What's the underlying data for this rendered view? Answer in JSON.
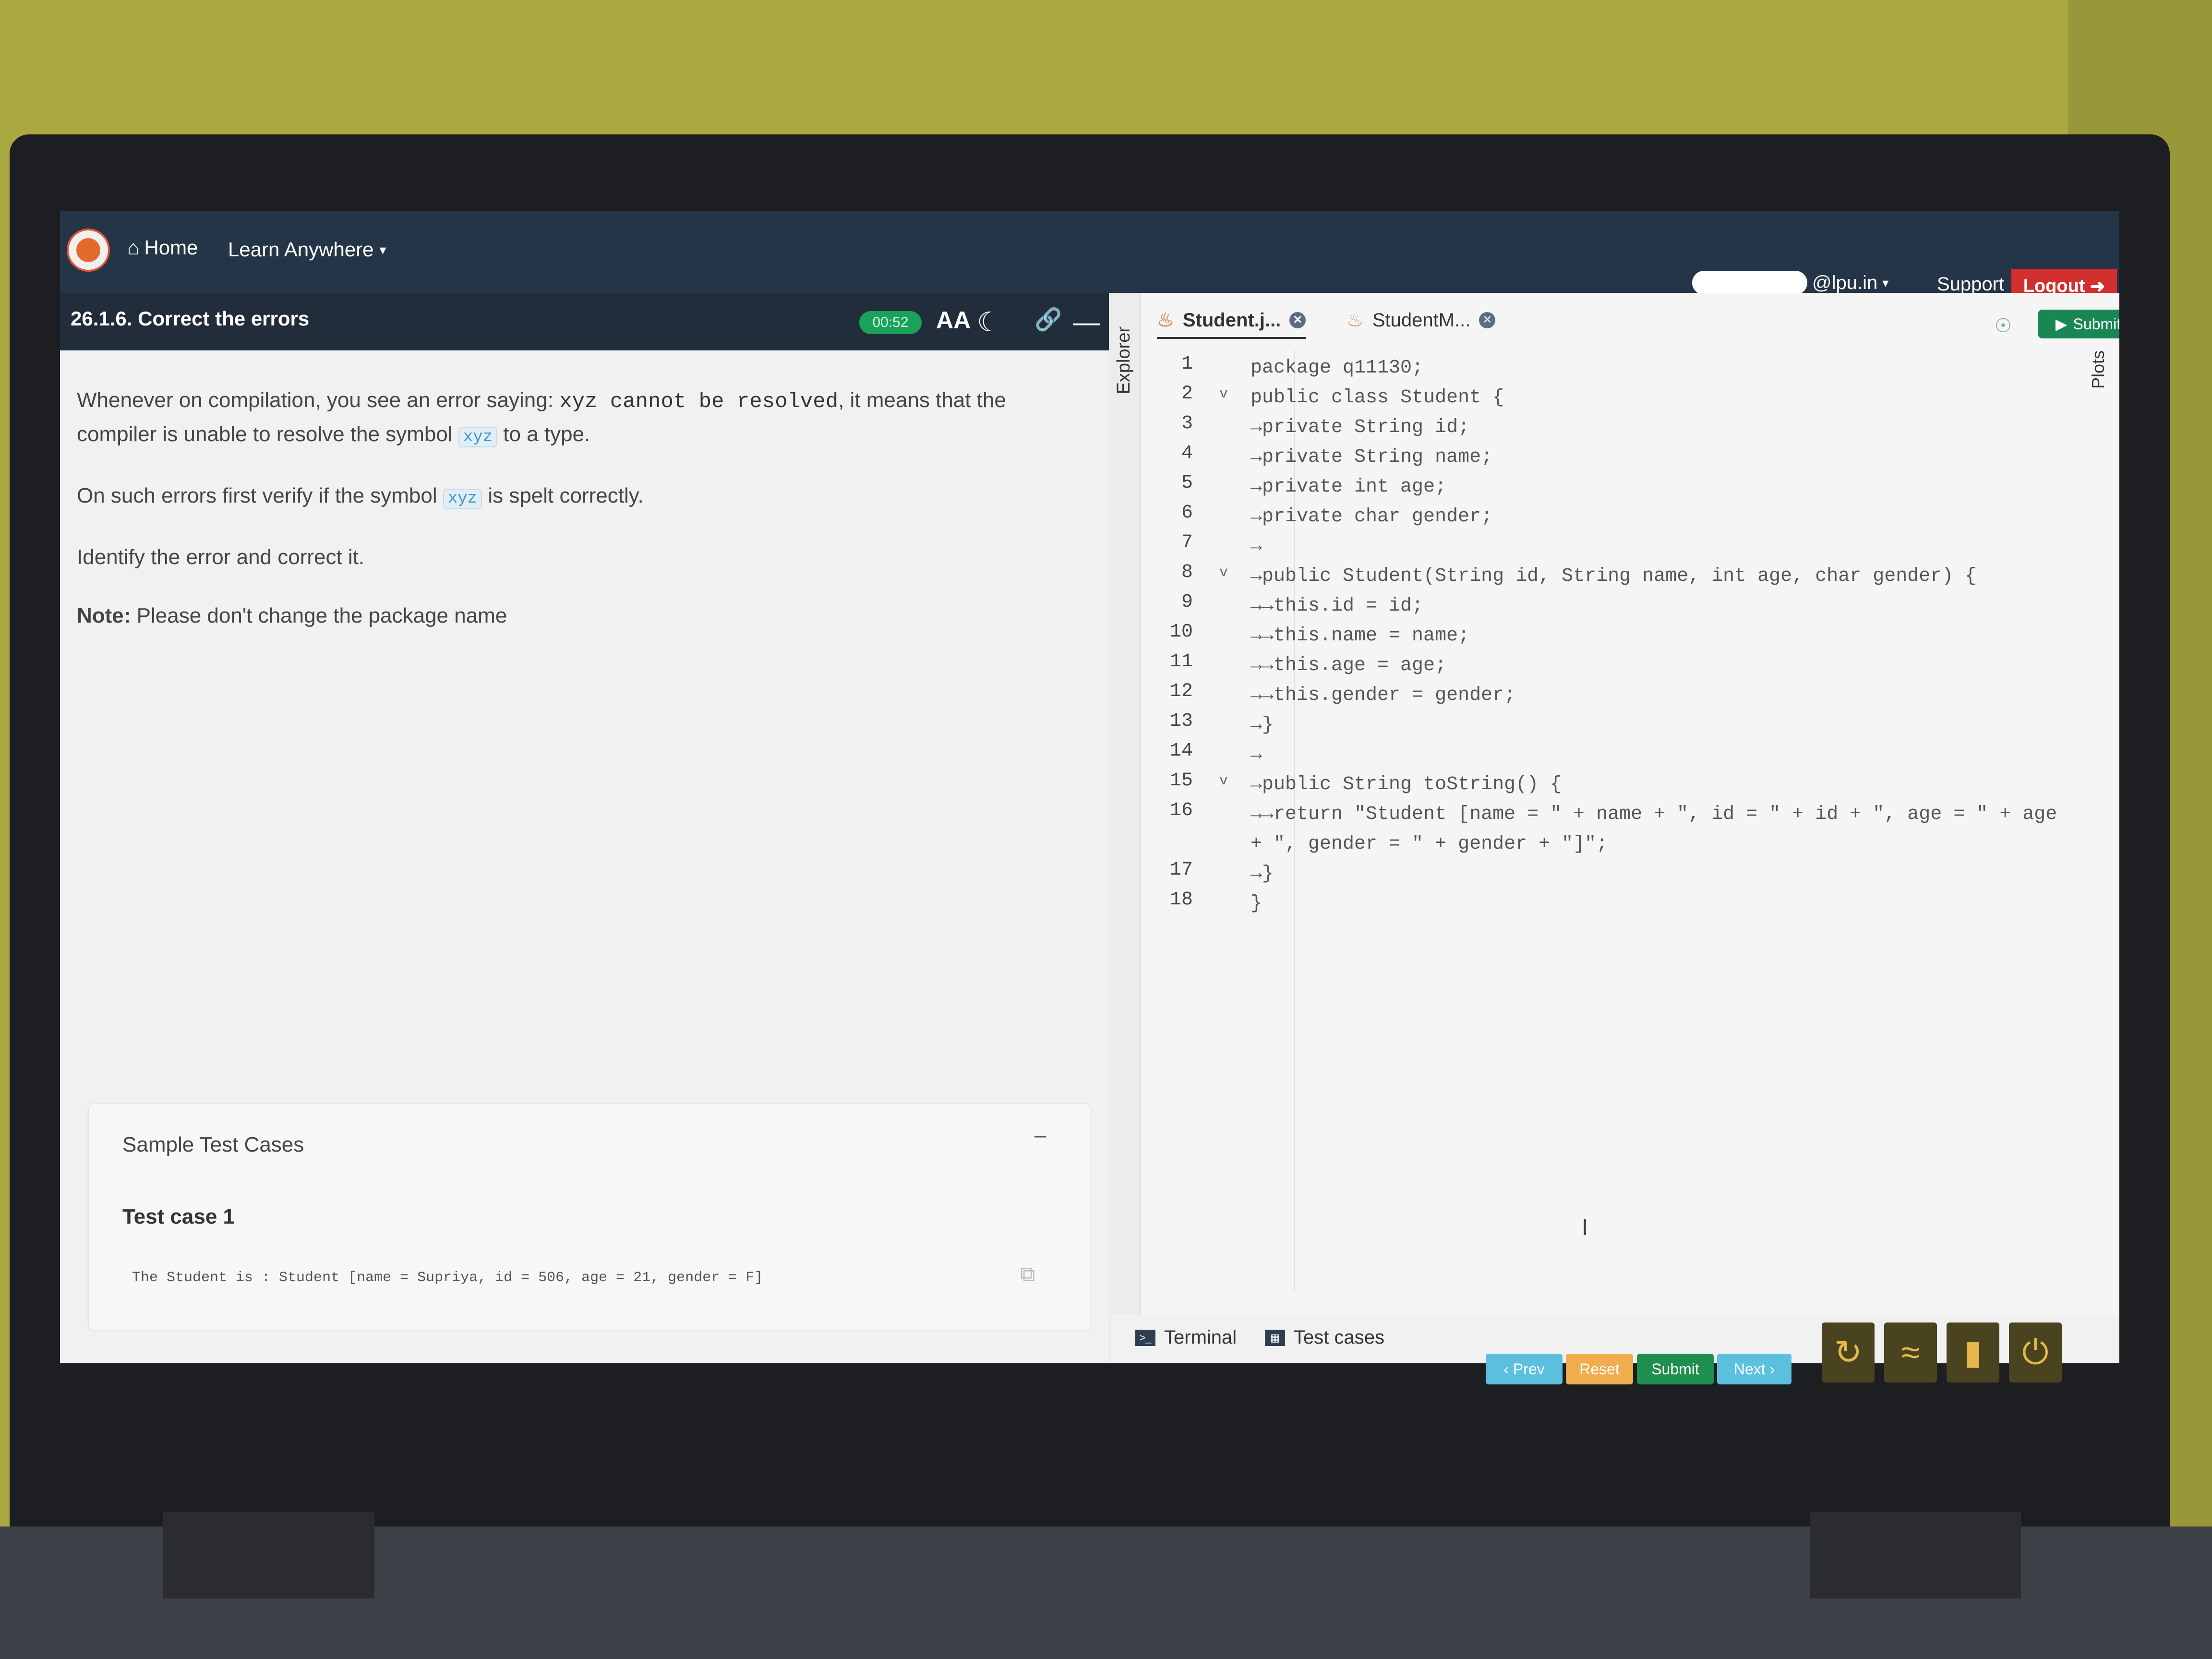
{
  "nav": {
    "home_label": "Home",
    "learn_label": "Learn Anywhere",
    "user_email_suffix": "@lpu.in",
    "support_label": "Support",
    "logout_label": "Logout"
  },
  "problem": {
    "title": "26.1.6. Correct the errors",
    "timer": "00:52",
    "para1_pre": "Whenever on compilation, you see an error saying: ",
    "para1_code": "xyz cannot be resolved",
    "para1_post": ", it means that the compiler is unable to resolve the symbol ",
    "symbol_tag": "xyz",
    "para1_end": " to a type.",
    "para2_pre": "On such errors first verify if the symbol ",
    "para2_post": " is spelt correctly.",
    "para3": "Identify the error and correct it.",
    "note_label": "Note:",
    "note_text": " Please don't change the package name"
  },
  "sample": {
    "title": "Sample Test Cases",
    "collapse": "–",
    "case_title": "Test case 1",
    "output": "The Student is : Student [name = Supriya, id = 506, age = 21, gender = F]"
  },
  "editor": {
    "explorer_label": "Explorer",
    "plots_label": "Plots",
    "tabs": [
      "Student.j...",
      "StudentM..."
    ],
    "submit_label": "Submit",
    "lines": [
      {
        "n": "1",
        "fold": "",
        "code": "package q11130;"
      },
      {
        "n": "2",
        "fold": "v",
        "code": "public class Student {"
      },
      {
        "n": "3",
        "fold": "",
        "code": "→private String id;"
      },
      {
        "n": "4",
        "fold": "",
        "code": "→private String name;"
      },
      {
        "n": "5",
        "fold": "",
        "code": "→private int age;"
      },
      {
        "n": "6",
        "fold": "",
        "code": "→private char gender;"
      },
      {
        "n": "7",
        "fold": "",
        "code": "→"
      },
      {
        "n": "8",
        "fold": "v",
        "code": "→public Student(String id, String name, int age, char gender) {"
      },
      {
        "n": "9",
        "fold": "",
        "code": "→→this.id = id;"
      },
      {
        "n": "10",
        "fold": "",
        "code": "→→this.name = name;"
      },
      {
        "n": "11",
        "fold": "",
        "code": "→→this.age = age;"
      },
      {
        "n": "12",
        "fold": "",
        "code": "→→this.gender = gender;"
      },
      {
        "n": "13",
        "fold": "",
        "code": "→}"
      },
      {
        "n": "14",
        "fold": "",
        "code": "→"
      },
      {
        "n": "15",
        "fold": "v",
        "code": "→public String toString() {"
      },
      {
        "n": "16",
        "fold": "",
        "code": "→→return \"Student [name = \" + name + \", id = \" + id + \", age = \" + age + \", gender = \" + gender + \"]\";"
      },
      {
        "n": "17",
        "fold": "",
        "code": "→}"
      },
      {
        "n": "18",
        "fold": "",
        "code": "}"
      }
    ],
    "terminal_label": "Terminal",
    "testcases_label": "Test cases"
  },
  "footer": {
    "prev_label": "‹ Prev",
    "reset_label": "Reset",
    "submit_label": "Submit",
    "next_label": "Next ›"
  },
  "colors": {
    "nav_bg": "#233546",
    "logout_bg": "#d32f2f",
    "submit_green": "#198754",
    "timer_green": "#1aa15a",
    "prev_blue": "#5bc0de",
    "reset_yellow": "#f0ad4e",
    "next_blue": "#5bc0de"
  }
}
